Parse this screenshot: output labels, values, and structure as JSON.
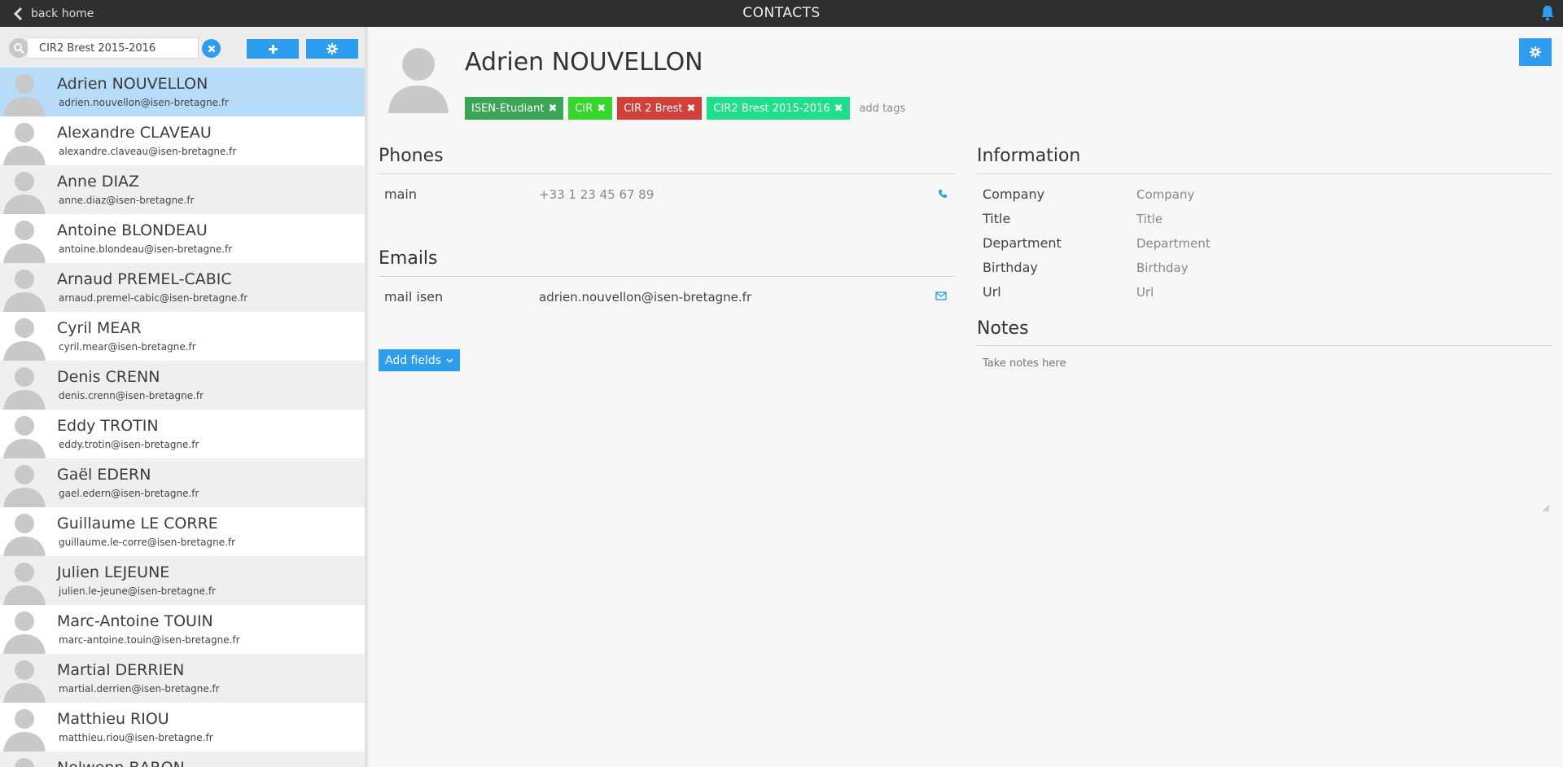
{
  "topbar": {
    "back_label": "back home",
    "title": "CONTACTS"
  },
  "colors": {
    "accent": "#2d9df0",
    "topbar": "#2f2f2f",
    "selected_row": "#b6dcf9"
  },
  "sidebar": {
    "search_value": "CIR2 Brest 2015-2016",
    "contacts": [
      {
        "name": "Adrien NOUVELLON",
        "email": "adrien.nouvellon@isen-bretagne.fr"
      },
      {
        "name": "Alexandre CLAVEAU",
        "email": "alexandre.claveau@isen-bretagne.fr"
      },
      {
        "name": "Anne DIAZ",
        "email": "anne.diaz@isen-bretagne.fr"
      },
      {
        "name": "Antoine BLONDEAU",
        "email": "antoine.blondeau@isen-bretagne.fr"
      },
      {
        "name": "Arnaud PREMEL-CABIC",
        "email": "arnaud.premel-cabic@isen-bretagne.fr"
      },
      {
        "name": "Cyril MEAR",
        "email": "cyril.mear@isen-bretagne.fr"
      },
      {
        "name": "Denis CRENN",
        "email": "denis.crenn@isen-bretagne.fr"
      },
      {
        "name": "Eddy TROTIN",
        "email": "eddy.trotin@isen-bretagne.fr"
      },
      {
        "name": "Gaël EDERN",
        "email": "gael.edern@isen-bretagne.fr"
      },
      {
        "name": "Guillaume LE CORRE",
        "email": "guillaume.le-corre@isen-bretagne.fr"
      },
      {
        "name": "Julien LEJEUNE",
        "email": "julien.le-jeune@isen-bretagne.fr"
      },
      {
        "name": "Marc-Antoine TOUIN",
        "email": "marc-antoine.touin@isen-bretagne.fr"
      },
      {
        "name": "Martial DERRIEN",
        "email": "martial.derrien@isen-bretagne.fr"
      },
      {
        "name": "Matthieu RIOU",
        "email": "matthieu.riou@isen-bretagne.fr"
      },
      {
        "name": "Nolwenn BARON",
        "email": ""
      }
    ]
  },
  "contact": {
    "name": "Adrien NOUVELLON",
    "tags": [
      {
        "label": "ISEN-Etudiant",
        "color": "#3aa655"
      },
      {
        "label": "CIR",
        "color": "#37d62b"
      },
      {
        "label": "CIR 2 Brest",
        "color": "#d2403a"
      },
      {
        "label": "CIR2 Brest 2015-2016",
        "color": "#1fe08a"
      }
    ],
    "add_tags_placeholder": "add tags",
    "phones": {
      "title": "Phones",
      "rows": [
        {
          "label": "main",
          "value": "+33 1 23 45 67 89"
        }
      ]
    },
    "emails": {
      "title": "Emails",
      "rows": [
        {
          "label": "mail  isen",
          "value": "adrien.nouvellon@isen-bretagne.fr"
        }
      ]
    },
    "add_fields_label": "Add fields",
    "information": {
      "title": "Information",
      "rows": [
        {
          "label": "Company",
          "placeholder": "Company"
        },
        {
          "label": "Title",
          "placeholder": "Title"
        },
        {
          "label": "Department",
          "placeholder": "Department"
        },
        {
          "label": "Birthday",
          "placeholder": "Birthday"
        },
        {
          "label": "Url",
          "placeholder": "Url"
        }
      ]
    },
    "notes": {
      "title": "Notes",
      "placeholder": "Take notes here"
    }
  }
}
